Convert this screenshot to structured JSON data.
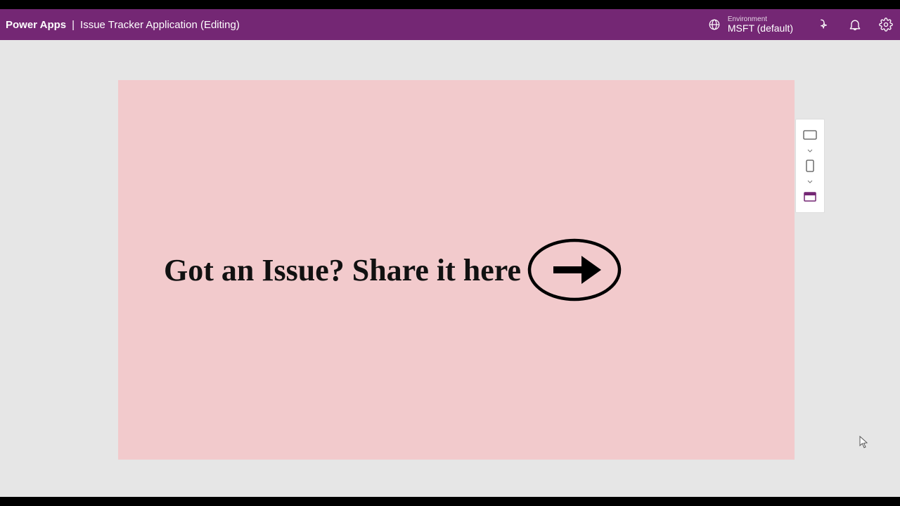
{
  "header": {
    "brand": "Power Apps",
    "separator": "|",
    "app_name": "Issue Tracker Application (Editing)",
    "environment_label": "Environment",
    "environment_value": "MSFT (default)"
  },
  "canvas": {
    "prompt_text": "Got an Issue? Share it here"
  },
  "colors": {
    "header_bg": "#742774",
    "canvas_bg": "#f2cacc",
    "stage_bg": "#e6e6e6",
    "accent": "#742774"
  }
}
